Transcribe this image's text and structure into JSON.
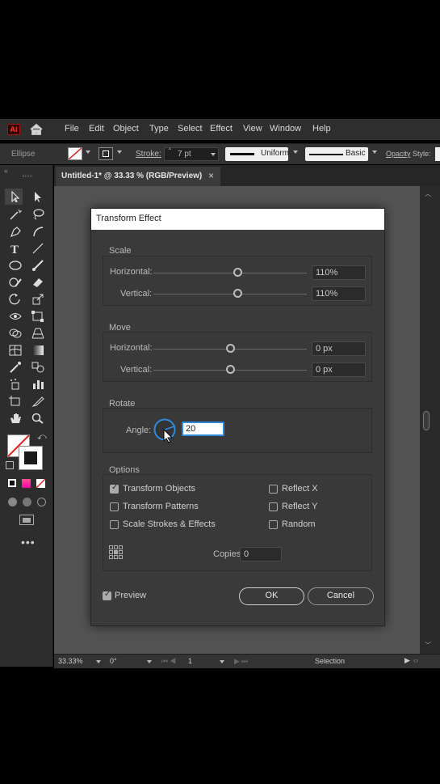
{
  "app": {
    "logo": "Ai",
    "menu": [
      "File",
      "Edit",
      "Object",
      "Type",
      "Select",
      "Effect",
      "View",
      "Window",
      "Help"
    ]
  },
  "control_bar": {
    "selection_type": "Ellipse",
    "stroke_label": "Stroke:",
    "stroke_weight": "7 pt",
    "stroke_profile": "Uniform",
    "brush": "Basic",
    "opacity_label": "Opacity",
    "style_label": "Style:"
  },
  "document_tab": {
    "title": "Untitled-1* @ 33.33 % (RGB/Preview)",
    "close": "×"
  },
  "status_bar": {
    "zoom": "33.33%",
    "rotation": "0°",
    "artboard": "1",
    "tool": "Selection"
  },
  "dialog": {
    "title": "Transform Effect",
    "scale": {
      "title": "Scale",
      "horizontal_label": "Horizontal:",
      "horizontal_value": "110%",
      "vertical_label": "Vertical:",
      "vertical_value": "110%"
    },
    "move": {
      "title": "Move",
      "horizontal_label": "Horizontal:",
      "horizontal_value": "0 px",
      "vertical_label": "Vertical:",
      "vertical_value": "0 px"
    },
    "rotate": {
      "title": "Rotate",
      "angle_label": "Angle:",
      "angle_value": "20"
    },
    "options": {
      "title": "Options",
      "transform_objects": "Transform Objects",
      "transform_patterns": "Transform Patterns",
      "scale_strokes": "Scale Strokes & Effects",
      "reflect_x": "Reflect X",
      "reflect_y": "Reflect Y",
      "random": "Random",
      "copies_label": "Copies",
      "copies_value": "0"
    },
    "preview_label": "Preview",
    "ok_label": "OK",
    "cancel_label": "Cancel"
  },
  "colors": {
    "ui_dark": "#2d2d2d",
    "canvas": "#535353",
    "dialog": "#3a3a3a",
    "angle_dial": "#2f8be0",
    "ai_red": "#ff3b2f"
  }
}
